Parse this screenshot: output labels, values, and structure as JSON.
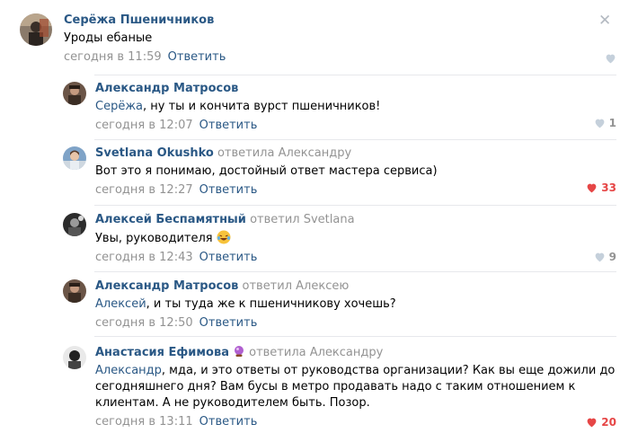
{
  "reply_label": "Ответить",
  "comments": [
    {
      "author": "Серёжа Пшеничников",
      "replied_to": "",
      "mention": "",
      "text": "Уроды ебаные",
      "time": "сегодня в 11:59",
      "likes": "",
      "liked": false
    },
    {
      "author": "Александр Матросов",
      "replied_to": "",
      "mention": "Серёжа",
      "text": ", ну ты и кончита вурст пшеничников!",
      "time": "сегодня в 12:07",
      "likes": "1",
      "liked": false
    },
    {
      "author": "Svetlana Okushko",
      "replied_to": "ответила Александру",
      "mention": "",
      "text": "Вот это я понимаю, достойный ответ мастера сервиса)",
      "time": "сегодня в 12:27",
      "likes": "33",
      "liked": true
    },
    {
      "author": "Алексей Беспамятный",
      "replied_to": "ответил Svetlana",
      "mention": "",
      "text": "Увы, руководителя",
      "time": "сегодня в 12:43",
      "likes": "9",
      "liked": false
    },
    {
      "author": "Александр Матросов",
      "replied_to": "ответил Алексею",
      "mention": "Алексей",
      "text": ", и ты туда же к пшеничникову хочешь?",
      "time": "сегодня в 12:50",
      "likes": "",
      "liked": false
    },
    {
      "author": "Анастасия Ефимова",
      "replied_to": "ответила Александру",
      "mention": "Александр",
      "text": ", мда, и это ответы от руководства организации? Как вы еще дожили до сегодняшнего дня? Вам бусы в метро продавать надо с таким отношением к клиентам. А не руководителем быть. Позор.",
      "time": "сегодня в 13:11",
      "likes": "20",
      "liked": true
    }
  ],
  "colors": {
    "link": "#2a5885",
    "muted": "#939393",
    "liked": "#e64646"
  }
}
